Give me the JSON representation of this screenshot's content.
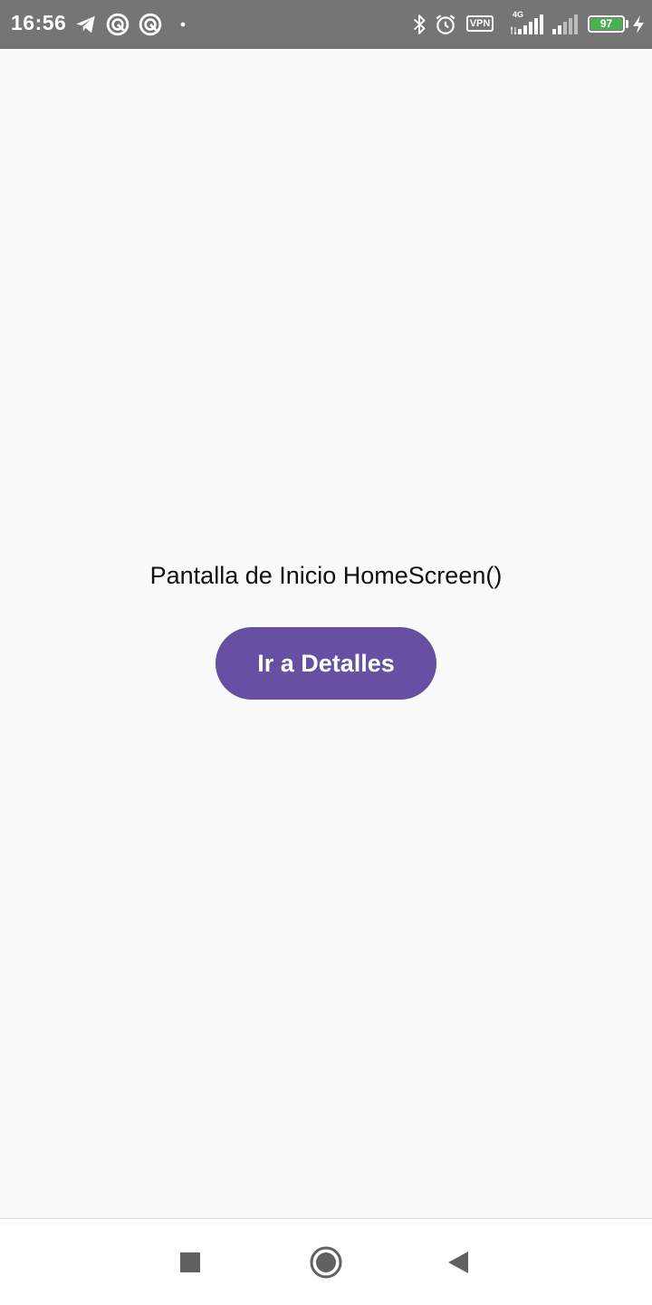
{
  "status_bar": {
    "time": "16:56",
    "vpn_label": "VPN",
    "network_type": "4G",
    "battery_level": "97",
    "battery_color": "#4caf50",
    "icons": [
      "telegram-icon",
      "app-notification-icon",
      "app-notification-icon",
      "dot-icon",
      "bluetooth-icon",
      "alarm-icon",
      "vpn-icon",
      "signal-icon",
      "signal-weak-icon",
      "battery-icon",
      "charging-icon"
    ]
  },
  "main": {
    "title": "Pantalla de Inicio HomeScreen()",
    "button_label": "Ir a Detalles",
    "button_color": "#6750a4",
    "background": "#fafafa"
  },
  "nav_bar": {
    "icons": [
      "recents-icon",
      "home-icon",
      "back-icon"
    ]
  }
}
